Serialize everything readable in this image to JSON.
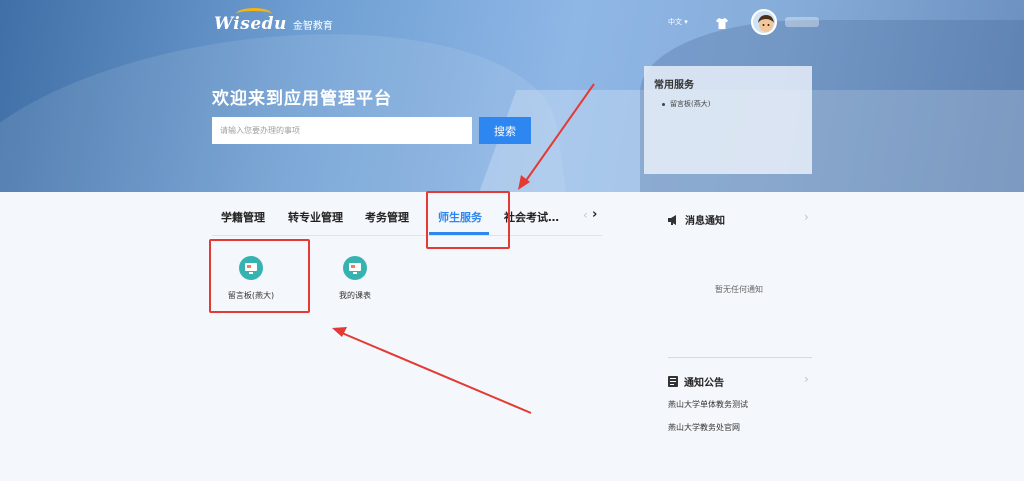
{
  "header": {
    "logo_text": "Wisedu",
    "logo_cn": "金智教育",
    "language": "中文 ▾",
    "welcome": "欢迎来到应用管理平台"
  },
  "search": {
    "placeholder": "请输入您要办理的事项",
    "button": "搜索"
  },
  "common_services": {
    "title": "常用服务",
    "items": [
      "留言板(燕大)"
    ]
  },
  "tabs": [
    {
      "label": "学籍管理"
    },
    {
      "label": "转专业管理"
    },
    {
      "label": "考务管理"
    },
    {
      "label": "师生服务",
      "active": true
    },
    {
      "label": "社会考试…"
    }
  ],
  "tab_nav": {
    "prev": "‹",
    "next": "›"
  },
  "apps": [
    {
      "label": "留言板(燕大)",
      "icon": "monitor-icon"
    },
    {
      "label": "我的课表",
      "icon": "monitor-icon"
    }
  ],
  "notices": {
    "title": "消息通知",
    "empty": "暂无任何通知",
    "icon": "megaphone-icon"
  },
  "announcements": {
    "title": "通知公告",
    "icon": "document-icon",
    "items": [
      "燕山大学单体教务测试",
      "燕山大学教务处官网"
    ]
  },
  "colors": {
    "accent": "#2e86f0",
    "annotation": "#e43a33",
    "app_icon": "#36b3b1"
  }
}
